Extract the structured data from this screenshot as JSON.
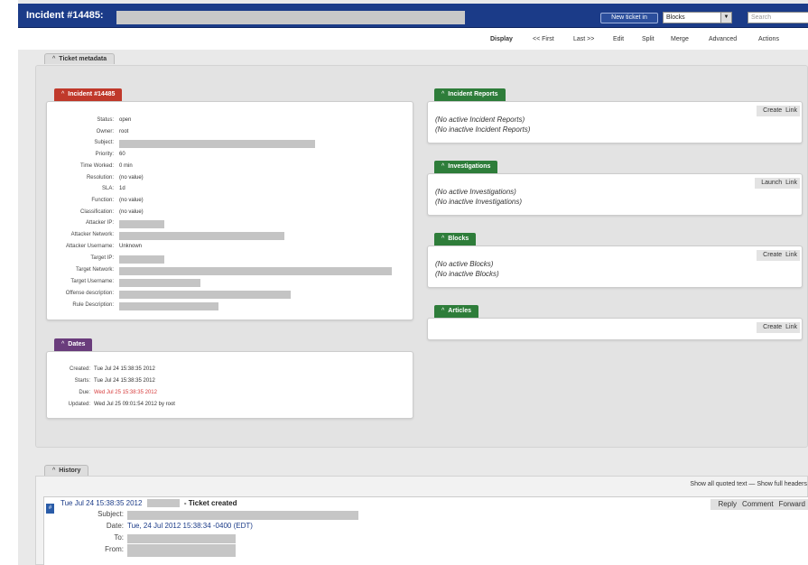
{
  "header": {
    "title": "Incident #14485:",
    "new_ticket_label": "New ticket in",
    "queue_value": "Blocks",
    "search_placeholder": "Search"
  },
  "menu": {
    "items": [
      "Display",
      "<< First",
      "Last >>",
      "Edit",
      "Split",
      "Merge",
      "Advanced",
      "Actions"
    ]
  },
  "metadata_tab": "Ticket metadata",
  "incident": {
    "title": "Incident #14485",
    "fields": [
      {
        "label": "Status:",
        "value": "open"
      },
      {
        "label": "Owner:",
        "value": "root"
      },
      {
        "label": "Subject:",
        "value": ""
      },
      {
        "label": "Priority:",
        "value": "60"
      },
      {
        "label": "Time Worked:",
        "value": "0 min"
      },
      {
        "label": "Resolution:",
        "value": "(no value)"
      },
      {
        "label": "SLA:",
        "value": "1d"
      },
      {
        "label": "Function:",
        "value": "(no value)"
      },
      {
        "label": "Classification:",
        "value": "(no value)"
      },
      {
        "label": "Attacker IP:",
        "value": ""
      },
      {
        "label": "Attacker Network:",
        "value": ""
      },
      {
        "label": "Attacker Username:",
        "value": "Unknown"
      },
      {
        "label": "Target IP:",
        "value": ""
      },
      {
        "label": "Target Network:",
        "value": ""
      },
      {
        "label": "Target Username:",
        "value": ""
      },
      {
        "label": "Offense description:",
        "value": ""
      },
      {
        "label": "Rule Description:",
        "value": ""
      }
    ]
  },
  "dates": {
    "title": "Dates",
    "rows": [
      {
        "label": "Created:",
        "value": "Tue Jul 24 15:38:35 2012"
      },
      {
        "label": "Starts:",
        "value": "Tue Jul 24 15:38:35 2012"
      },
      {
        "label": "Due:",
        "value": "Wed Jul 25 15:38:35 2012"
      },
      {
        "label": "Updated:",
        "value": "Wed Jul 25 09:01:54 2012 by root"
      }
    ]
  },
  "right_boxes": [
    {
      "title": "Incident Reports",
      "actions": [
        "Create",
        "Link"
      ],
      "lines": [
        "(No active Incident Reports)",
        "(No inactive Incident Reports)"
      ]
    },
    {
      "title": "Investigations",
      "actions": [
        "Launch",
        "Link"
      ],
      "lines": [
        "(No active Investigations)",
        "(No inactive Investigations)"
      ]
    },
    {
      "title": "Blocks",
      "actions": [
        "Create",
        "Link"
      ],
      "lines": [
        "(No active Blocks)",
        "(No inactive Blocks)"
      ]
    },
    {
      "title": "Articles",
      "actions": [
        "Create",
        "Link"
      ],
      "lines": []
    }
  ],
  "history": {
    "tab": "History",
    "links": "Show all quoted text — Show full headers",
    "entry": {
      "datetime": "Tue Jul 24 15:38:35 2012",
      "event": "- Ticket created",
      "actions": [
        "Reply",
        "Comment",
        "Forward"
      ],
      "headers": [
        {
          "label": "Subject:",
          "value": ""
        },
        {
          "label": "Date:",
          "value": "Tue, 24 Jul 2012 15:38:34 -0400 (EDT)"
        },
        {
          "label": "To:",
          "value": ""
        },
        {
          "label": "From:",
          "value": ""
        }
      ]
    }
  },
  "colors": {
    "topbar": "#1b3b88",
    "incident_red": "#c0392b",
    "dates_purple": "#6a3c7c",
    "section_green": "#2e7d3a",
    "overdue": "#d63c3c"
  }
}
